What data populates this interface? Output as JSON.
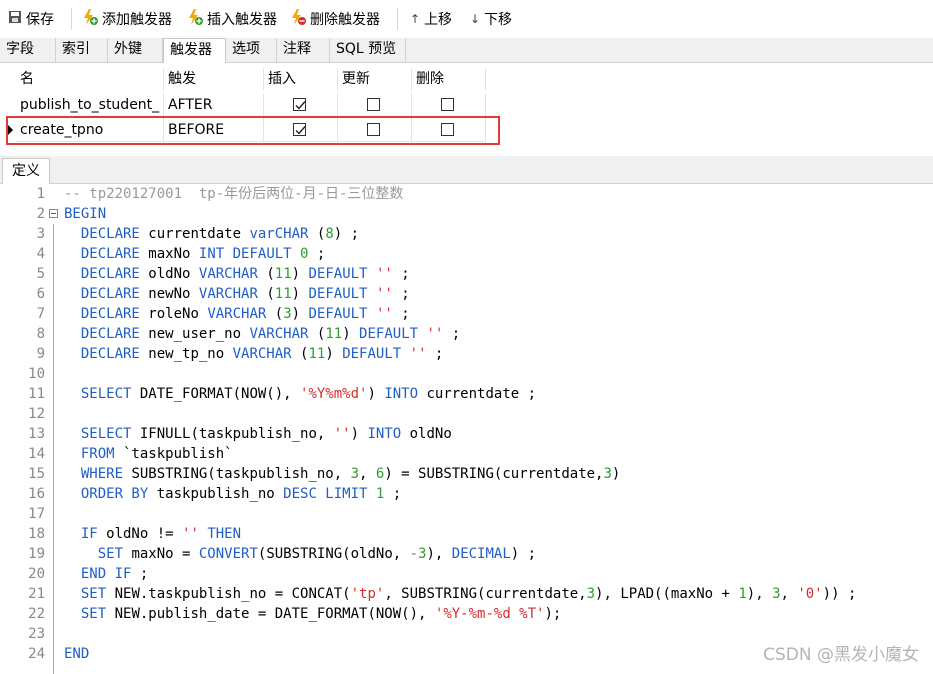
{
  "toolbar": {
    "save": "保存",
    "add_trigger": "添加触发器",
    "insert_trigger": "插入触发器",
    "delete_trigger": "删除触发器",
    "move_up": "上移",
    "move_down": "下移"
  },
  "tabs": [
    "字段",
    "索引",
    "外键",
    "触发器",
    "选项",
    "注释",
    "SQL 预览"
  ],
  "active_tab": "触发器",
  "grid": {
    "headers": [
      "名",
      "触发",
      "插入",
      "更新",
      "删除"
    ],
    "rows": [
      {
        "name": "publish_to_student_",
        "timing": "AFTER",
        "insert": true,
        "update": false,
        "delete": false
      },
      {
        "name": "create_tpno",
        "timing": "BEFORE",
        "insert": true,
        "update": false,
        "delete": false
      }
    ]
  },
  "section_tab": "定义",
  "code_lines": [
    [
      [
        "c-cm",
        "-- tp220127001  tp-年份后两位-月-日-三位整数"
      ]
    ],
    [
      [
        "c-kw",
        "BEGIN"
      ]
    ],
    [
      [
        "c-id",
        "  "
      ],
      [
        "c-kw",
        "DECLARE"
      ],
      [
        "c-id",
        " currentdate "
      ],
      [
        "c-kw",
        "varCHAR"
      ],
      [
        "c-id",
        " ("
      ],
      [
        "c-num",
        "8"
      ],
      [
        "c-id",
        ") ;"
      ]
    ],
    [
      [
        "c-id",
        "  "
      ],
      [
        "c-kw",
        "DECLARE"
      ],
      [
        "c-id",
        " maxNo "
      ],
      [
        "c-kw",
        "INT DEFAULT"
      ],
      [
        "c-id",
        " "
      ],
      [
        "c-num",
        "0"
      ],
      [
        "c-id",
        " ;"
      ]
    ],
    [
      [
        "c-id",
        "  "
      ],
      [
        "c-kw",
        "DECLARE"
      ],
      [
        "c-id",
        " oldNo "
      ],
      [
        "c-kw",
        "VARCHAR"
      ],
      [
        "c-id",
        " ("
      ],
      [
        "c-num",
        "11"
      ],
      [
        "c-id",
        ") "
      ],
      [
        "c-kw",
        "DEFAULT"
      ],
      [
        "c-id",
        " "
      ],
      [
        "c-str",
        "''"
      ],
      [
        "c-id",
        " ;"
      ]
    ],
    [
      [
        "c-id",
        "  "
      ],
      [
        "c-kw",
        "DECLARE"
      ],
      [
        "c-id",
        " newNo "
      ],
      [
        "c-kw",
        "VARCHAR"
      ],
      [
        "c-id",
        " ("
      ],
      [
        "c-num",
        "11"
      ],
      [
        "c-id",
        ") "
      ],
      [
        "c-kw",
        "DEFAULT"
      ],
      [
        "c-id",
        " "
      ],
      [
        "c-str",
        "''"
      ],
      [
        "c-id",
        " ;"
      ]
    ],
    [
      [
        "c-id",
        "  "
      ],
      [
        "c-kw",
        "DECLARE"
      ],
      [
        "c-id",
        " roleNo "
      ],
      [
        "c-kw",
        "VARCHAR"
      ],
      [
        "c-id",
        " ("
      ],
      [
        "c-num",
        "3"
      ],
      [
        "c-id",
        ") "
      ],
      [
        "c-kw",
        "DEFAULT"
      ],
      [
        "c-id",
        " "
      ],
      [
        "c-str",
        "''"
      ],
      [
        "c-id",
        " ;"
      ]
    ],
    [
      [
        "c-id",
        "  "
      ],
      [
        "c-kw",
        "DECLARE"
      ],
      [
        "c-id",
        " new_user_no "
      ],
      [
        "c-kw",
        "VARCHAR"
      ],
      [
        "c-id",
        " ("
      ],
      [
        "c-num",
        "11"
      ],
      [
        "c-id",
        ") "
      ],
      [
        "c-kw",
        "DEFAULT"
      ],
      [
        "c-id",
        " "
      ],
      [
        "c-str",
        "''"
      ],
      [
        "c-id",
        " ;"
      ]
    ],
    [
      [
        "c-id",
        "  "
      ],
      [
        "c-kw",
        "DECLARE"
      ],
      [
        "c-id",
        " new_tp_no "
      ],
      [
        "c-kw",
        "VARCHAR"
      ],
      [
        "c-id",
        " ("
      ],
      [
        "c-num",
        "11"
      ],
      [
        "c-id",
        ") "
      ],
      [
        "c-kw",
        "DEFAULT"
      ],
      [
        "c-id",
        " "
      ],
      [
        "c-str",
        "''"
      ],
      [
        "c-id",
        " ;"
      ]
    ],
    [],
    [
      [
        "c-id",
        "  "
      ],
      [
        "c-kw",
        "SELECT"
      ],
      [
        "c-id",
        " DATE_FORMAT(NOW(), "
      ],
      [
        "c-str",
        "'%Y%m%d'"
      ],
      [
        "c-id",
        ") "
      ],
      [
        "c-kw",
        "INTO"
      ],
      [
        "c-id",
        " currentdate ;"
      ]
    ],
    [],
    [
      [
        "c-id",
        "  "
      ],
      [
        "c-kw",
        "SELECT"
      ],
      [
        "c-id",
        " IFNULL(taskpublish_no, "
      ],
      [
        "c-str",
        "''"
      ],
      [
        "c-id",
        ") "
      ],
      [
        "c-kw",
        "INTO"
      ],
      [
        "c-id",
        " oldNo"
      ]
    ],
    [
      [
        "c-id",
        "  "
      ],
      [
        "c-kw",
        "FROM"
      ],
      [
        "c-id",
        " `taskpublish`"
      ]
    ],
    [
      [
        "c-id",
        "  "
      ],
      [
        "c-kw",
        "WHERE"
      ],
      [
        "c-id",
        " SUBSTRING(taskpublish_no, "
      ],
      [
        "c-num",
        "3"
      ],
      [
        "c-id",
        ", "
      ],
      [
        "c-num",
        "6"
      ],
      [
        "c-id",
        ") = SUBSTRING(currentdate,"
      ],
      [
        "c-num",
        "3"
      ],
      [
        "c-id",
        ")"
      ]
    ],
    [
      [
        "c-id",
        "  "
      ],
      [
        "c-kw",
        "ORDER BY"
      ],
      [
        "c-id",
        " taskpublish_no "
      ],
      [
        "c-kw",
        "DESC LIMIT"
      ],
      [
        "c-id",
        " "
      ],
      [
        "c-num",
        "1"
      ],
      [
        "c-id",
        " ;"
      ]
    ],
    [],
    [
      [
        "c-id",
        "  "
      ],
      [
        "c-kw",
        "IF"
      ],
      [
        "c-id",
        " oldNo != "
      ],
      [
        "c-str",
        "''"
      ],
      [
        "c-id",
        " "
      ],
      [
        "c-kw",
        "THEN"
      ]
    ],
    [
      [
        "c-id",
        "    "
      ],
      [
        "c-kw",
        "SET"
      ],
      [
        "c-id",
        " maxNo = "
      ],
      [
        "c-kw",
        "CONVERT"
      ],
      [
        "c-id",
        "(SUBSTRING(oldNo, "
      ],
      [
        "c-num",
        "-3"
      ],
      [
        "c-id",
        "), "
      ],
      [
        "c-kw",
        "DECIMAL"
      ],
      [
        "c-id",
        ") ;"
      ]
    ],
    [
      [
        "c-id",
        "  "
      ],
      [
        "c-kw",
        "END IF"
      ],
      [
        "c-id",
        " ;"
      ]
    ],
    [
      [
        "c-id",
        "  "
      ],
      [
        "c-kw",
        "SET"
      ],
      [
        "c-id",
        " NEW.taskpublish_no = CONCAT("
      ],
      [
        "c-str",
        "'tp'"
      ],
      [
        "c-id",
        ", SUBSTRING(currentdate,"
      ],
      [
        "c-num",
        "3"
      ],
      [
        "c-id",
        "), LPAD((maxNo + "
      ],
      [
        "c-num",
        "1"
      ],
      [
        "c-id",
        "), "
      ],
      [
        "c-num",
        "3"
      ],
      [
        "c-id",
        ", "
      ],
      [
        "c-str",
        "'0'"
      ],
      [
        "c-id",
        ")) ;"
      ]
    ],
    [
      [
        "c-id",
        "  "
      ],
      [
        "c-kw",
        "SET"
      ],
      [
        "c-id",
        " NEW.publish_date = DATE_FORMAT(NOW(), "
      ],
      [
        "c-str",
        "'%Y-%m-%d %T'"
      ],
      [
        "c-id",
        ");"
      ]
    ],
    [],
    [
      [
        "c-kw",
        "END"
      ]
    ]
  ],
  "watermark": "CSDN @黑发小魔女",
  "colors": {
    "selection_border": "#e03a3a",
    "keyword": "#1f5ec7",
    "number": "#2e9e2e",
    "string": "#d72d2d",
    "comment": "#999999"
  }
}
